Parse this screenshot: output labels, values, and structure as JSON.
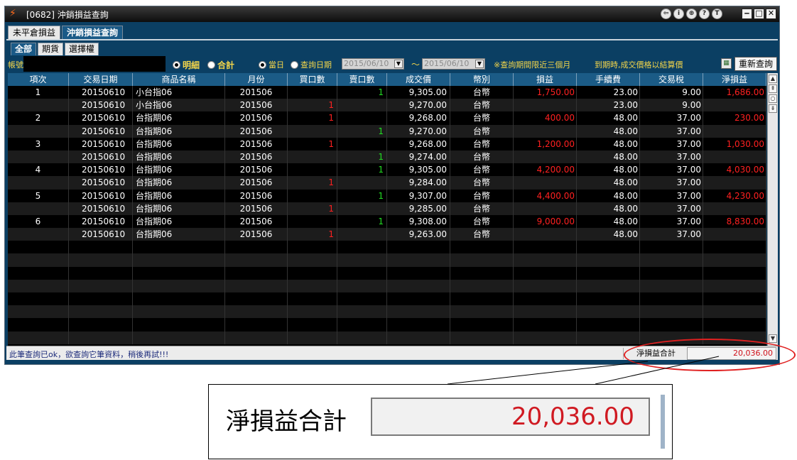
{
  "window": {
    "title": "[0682] 沖銷損益查詢",
    "title_icons": [
      "⇦",
      "i",
      "⊕",
      "?",
      "T"
    ],
    "win_buttons": [
      "‒",
      "□",
      "✕"
    ]
  },
  "tabs_main": [
    {
      "label": "未平倉損益",
      "active": false
    },
    {
      "label": "沖銷損益查詢",
      "active": true
    }
  ],
  "tabs_sub": [
    {
      "label": "全部",
      "active": true
    },
    {
      "label": "期貨",
      "active": false
    },
    {
      "label": "選擇權",
      "active": false
    }
  ],
  "filter": {
    "account_label": "帳號",
    "mode_detail": "明細",
    "mode_total": "合計",
    "today": "當日",
    "query_date": "查詢日期",
    "date_from": "2015/06/10",
    "date_to": "2015/06/10",
    "tilde": "～",
    "note_range": "※查詢期間限近三個月",
    "note_expiry": "到期時,成交價格以結算價",
    "requery_label": "重新查詢"
  },
  "table": {
    "columns": [
      "項次",
      "交易日期",
      "商品名稱",
      "月份",
      "買口數",
      "賣口數",
      "成交價",
      "幣別",
      "損益",
      "手續費",
      "交易稅",
      "淨損益"
    ],
    "rows": [
      [
        "1",
        "20150610",
        "小台指06",
        "201506",
        "",
        "1",
        "9,305.00",
        "台幣",
        "1,750.00",
        "23.00",
        "9.00",
        "1,686.00"
      ],
      [
        "",
        "20150610",
        "小台指06",
        "201506",
        "1",
        "",
        "9,270.00",
        "台幣",
        "",
        "23.00",
        "9.00",
        ""
      ],
      [
        "2",
        "20150610",
        "台指期06",
        "201506",
        "1",
        "",
        "9,268.00",
        "台幣",
        "400.00",
        "48.00",
        "37.00",
        "230.00"
      ],
      [
        "",
        "20150610",
        "台指期06",
        "201506",
        "",
        "1",
        "9,270.00",
        "台幣",
        "",
        "48.00",
        "37.00",
        ""
      ],
      [
        "3",
        "20150610",
        "台指期06",
        "201506",
        "1",
        "",
        "9,268.00",
        "台幣",
        "1,200.00",
        "48.00",
        "37.00",
        "1,030.00"
      ],
      [
        "",
        "20150610",
        "台指期06",
        "201506",
        "",
        "1",
        "9,274.00",
        "台幣",
        "",
        "48.00",
        "37.00",
        ""
      ],
      [
        "4",
        "20150610",
        "台指期06",
        "201506",
        "",
        "1",
        "9,305.00",
        "台幣",
        "4,200.00",
        "48.00",
        "37.00",
        "4,030.00"
      ],
      [
        "",
        "20150610",
        "台指期06",
        "201506",
        "1",
        "",
        "9,284.00",
        "台幣",
        "",
        "48.00",
        "37.00",
        ""
      ],
      [
        "5",
        "20150610",
        "台指期06",
        "201506",
        "",
        "1",
        "9,307.00",
        "台幣",
        "4,400.00",
        "48.00",
        "37.00",
        "4,230.00"
      ],
      [
        "",
        "20150610",
        "台指期06",
        "201506",
        "1",
        "",
        "9,285.00",
        "台幣",
        "",
        "48.00",
        "37.00",
        ""
      ],
      [
        "6",
        "20150610",
        "台指期06",
        "201506",
        "",
        "1",
        "9,308.00",
        "台幣",
        "9,000.00",
        "48.00",
        "37.00",
        "8,830.00"
      ],
      [
        "",
        "20150610",
        "台指期06",
        "201506",
        "1",
        "",
        "9,263.00",
        "台幣",
        "",
        "48.00",
        "37.00",
        ""
      ]
    ],
    "empty_rows": 8
  },
  "status": {
    "message": "此筆查詢已ok，欲查詢它筆資料，稍後再試!!!",
    "total_label": "淨損益合計",
    "total_value": "20,036.00"
  },
  "zoom": {
    "label": "淨損益合計",
    "value": "20,036.00"
  },
  "colors": {
    "profit": "#ff2020",
    "buy": "#ff2020",
    "sell": "#22dd22",
    "header_bg": "#1b5b86",
    "window_bg": "#0b3f63"
  }
}
